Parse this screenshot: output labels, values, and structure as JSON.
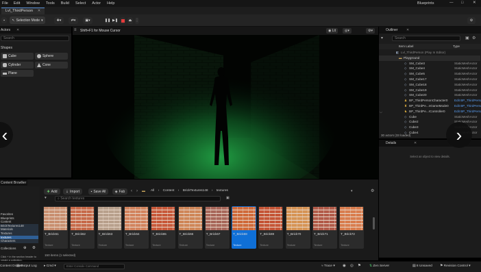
{
  "menu": [
    "File",
    "Edit",
    "Window",
    "Tools",
    "Build",
    "Select",
    "Actor",
    "Help"
  ],
  "project_name": "Blueprints",
  "level_tab": "Lvl_ThirdPerson",
  "toolbar": {
    "selection_mode": "Selection Mode"
  },
  "viewport": {
    "tab_label": "Shift+F1 for Mouse Cursor",
    "lit_label": "Lit",
    "scene_colors": {
      "glow": "#1c8a3a",
      "wall": "#203c22"
    }
  },
  "left_panel": {
    "tab_label": "Actors",
    "search_placeholder": "Search",
    "section_label": "Shapes",
    "shapes": [
      "Cube",
      "Sphere",
      "Cylinder",
      "Cone",
      "Plane"
    ]
  },
  "outliner": {
    "title": "Outliner",
    "search_placeholder": "Search",
    "col_label": "Item Label",
    "col_type": "Type",
    "rows": [
      {
        "label": "Lvl_ThirdPerson (Play In Editor)",
        "type": ""
      },
      {
        "label": "Playground",
        "type": ""
      },
      {
        "label": "SM_Cube3",
        "type": "StaticMeshActor"
      },
      {
        "label": "SM_Cube4",
        "type": "StaticMeshActor"
      },
      {
        "label": "SM_Cube5",
        "type": "StaticMeshActor"
      },
      {
        "label": "SM_Cube17",
        "type": "StaticMeshActor"
      },
      {
        "label": "SM_Cube18",
        "type": "StaticMeshActor"
      },
      {
        "label": "SM_Cube19",
        "type": "StaticMeshActor"
      },
      {
        "label": "SM_Cube20",
        "type": "StaticMeshActor"
      },
      {
        "label": "BP_ThirdPersonCharacter0",
        "type": "Edit BP_ThirdPerson"
      },
      {
        "label": "BP_ThirdPe...nGameMode0",
        "type": "Edit BP_ThirdPerson"
      },
      {
        "label": "BP_ThirdPe...rController0",
        "type": "Edit BP_ThirdPerson"
      },
      {
        "label": "Cube",
        "type": "StaticMeshActor"
      },
      {
        "label": "Cube2",
        "type": "StaticMeshActor"
      },
      {
        "label": "Cube3",
        "type": "StaticMeshActor"
      },
      {
        "label": "Cube4",
        "type": "StaticMeshActor"
      }
    ],
    "status": "30 actors (33 loaded)"
  },
  "details": {
    "title": "Details",
    "empty_text": "Select an object to view details."
  },
  "content_browser": {
    "tab_label": "Content Browser",
    "add_label": "Add",
    "import_label": "Import",
    "save_all_label": "Save All",
    "fab_label": "Fab",
    "breadcrumb": [
      "All",
      "Content",
      "BrickTextures148",
      "textures"
    ],
    "search_placeholder": "Search textures",
    "folders": [
      "Favorites",
      "Blueprints",
      "Content",
      "BrickTextures148",
      "Materials",
      "Textures",
      "textures",
      "Characters"
    ],
    "collections_label": "Collections",
    "collections_hint": "Click + in the section header to create a collection.",
    "items": [
      {
        "name": "T_Brick61",
        "type": "Texture",
        "color": "#c98f70"
      },
      {
        "name": "T_Brick62",
        "type": "Texture",
        "color": "#c76a4a"
      },
      {
        "name": "T_Brick63",
        "type": "Texture",
        "color": "#b8a08c"
      },
      {
        "name": "T_Brick64",
        "type": "Texture",
        "color": "#d2835d"
      },
      {
        "name": "T_Brick65",
        "type": "Texture",
        "color": "#c8593a"
      },
      {
        "name": "T_Brick66",
        "type": "Texture",
        "color": "#cf8658"
      },
      {
        "name": "T_Brick67",
        "type": "Texture",
        "color": "#a8675a"
      },
      {
        "name": "T_Brick68",
        "type": "Texture",
        "color": "#d06a3a"
      },
      {
        "name": "T_Brick69",
        "type": "Texture",
        "color": "#c55536"
      },
      {
        "name": "T_Brick70",
        "type": "Texture",
        "color": "#d69455"
      },
      {
        "name": "T_Brick71",
        "type": "Texture",
        "color": "#b25b49"
      },
      {
        "name": "T_Brick72",
        "type": "Texture",
        "color": "#d97d4e"
      }
    ],
    "selected_index": 7,
    "status": "150 items (1 selected)"
  },
  "bottom": {
    "drawer_label": "Content Drawer",
    "output_log_label": "Output Log",
    "cmd_label": "Cmd",
    "console_placeholder": "Enter Console Command",
    "trace_label": "Trace",
    "derived_label": "Zen Server",
    "unsaved_label": "8 Unsaved",
    "revision_label": "Revision Control"
  }
}
